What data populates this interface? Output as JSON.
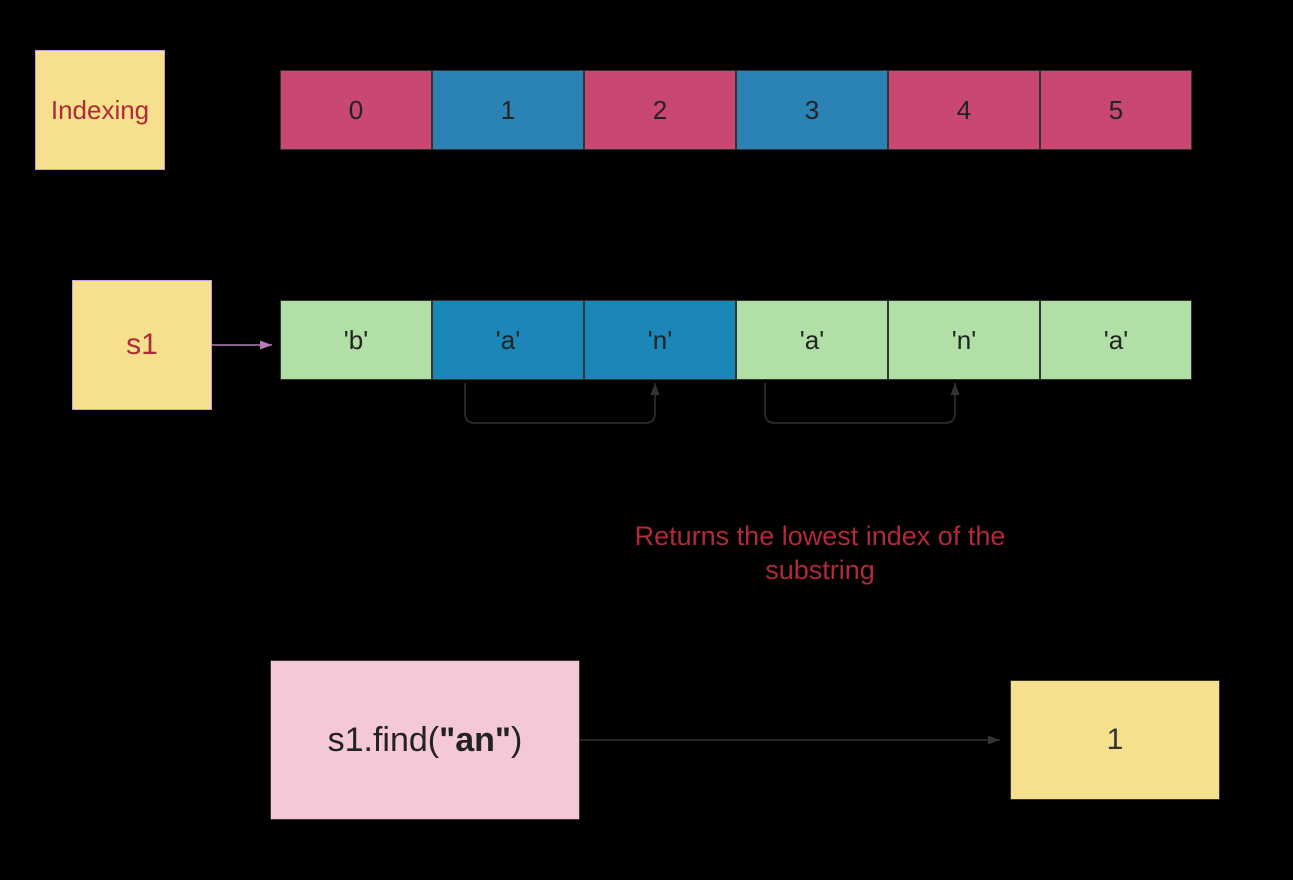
{
  "labels": {
    "indexing": "Indexing",
    "s1": "s1",
    "caption_line1": "Returns the lowest index of the",
    "caption_line2": "substring"
  },
  "indices": [
    "0",
    "1",
    "2",
    "3",
    "4",
    "5"
  ],
  "index_colors": [
    "pink",
    "blue",
    "pink",
    "blue",
    "pink",
    "pink"
  ],
  "chars": [
    "'b'",
    "'a'",
    "'n'",
    "'a'",
    "'n'",
    "'a'"
  ],
  "char_colors": [
    "green",
    "blue2",
    "blue2",
    "green",
    "green",
    "green"
  ],
  "find": {
    "prefix": "s1.find(",
    "arg": "\"an\"",
    "suffix": ")"
  },
  "result": "1"
}
